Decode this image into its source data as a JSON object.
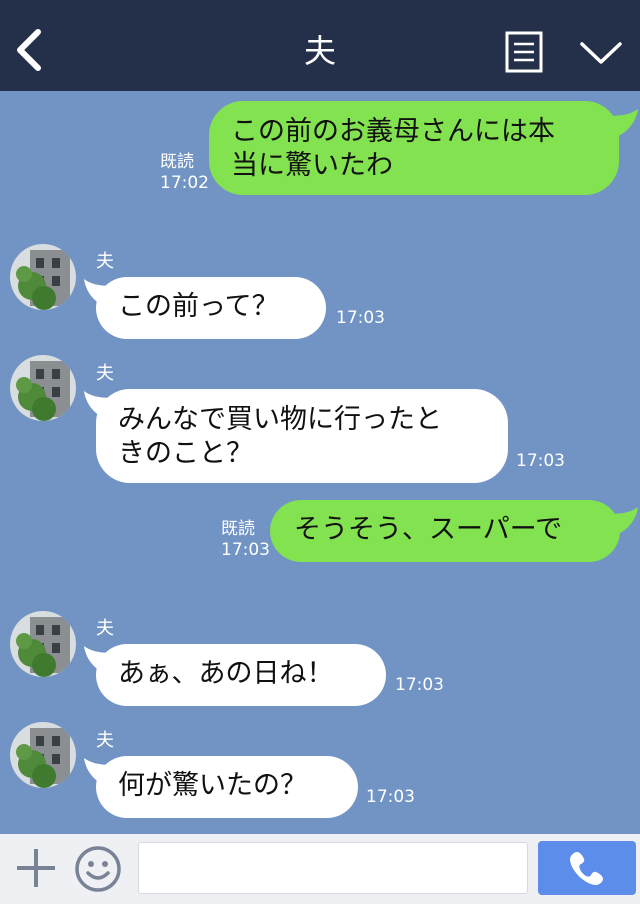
{
  "header": {
    "title": "夫",
    "back_icon": "chevron-left-icon",
    "menu_icon": "list-menu-icon",
    "expand_icon": "chevron-down-icon",
    "background": "#243049"
  },
  "chat": {
    "background": "#7194c4",
    "outgoing_color": "#83e24f",
    "incoming_color": "#ffffff",
    "messages": [
      {
        "direction": "out",
        "lines": [
          "この前のお義母さんには本",
          "当に驚いたわ"
        ],
        "read": "既読",
        "time": "17:02"
      },
      {
        "direction": "in",
        "sender": "夫",
        "lines": [
          "この前って？"
        ],
        "time": "17:03"
      },
      {
        "direction": "in",
        "sender": "夫",
        "lines": [
          "みんなで買い物に行ったと",
          "きのこと？"
        ],
        "time": "17:03"
      },
      {
        "direction": "out",
        "lines": [
          "そうそう、スーパーで"
        ],
        "read": "既読",
        "time": "17:03"
      },
      {
        "direction": "in",
        "sender": "夫",
        "lines": [
          "あぁ、あの日ね！"
        ],
        "time": "17:03"
      },
      {
        "direction": "in",
        "sender": "夫",
        "lines": [
          "何が驚いたの？"
        ],
        "time": "17:03"
      }
    ]
  },
  "footer": {
    "plus_icon": "plus-icon",
    "emoji_icon": "smiley-icon",
    "input_value": "",
    "call_icon": "phone-icon",
    "call_button_color": "#5c8dea"
  }
}
